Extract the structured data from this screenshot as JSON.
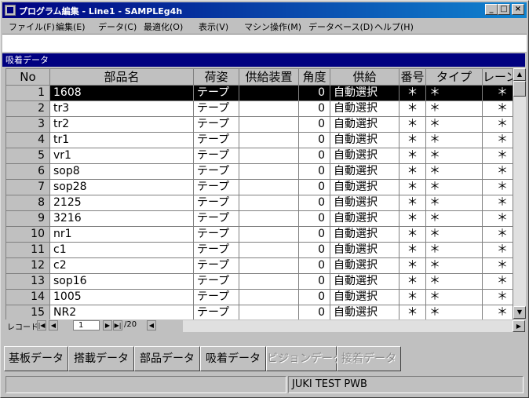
{
  "window": {
    "title": "プログラム編集 - Line1 - SAMPLEg4h"
  },
  "menu": [
    "ファイル(F)",
    "編集(E)",
    "データ(C)",
    "最適化(O)",
    "表示(V)",
    "マシン操作(M)",
    "データベース(D)",
    "ヘルプ(H)"
  ],
  "panel": {
    "title": "吸着データ"
  },
  "columns": [
    "No",
    "部品名",
    "荷姿",
    "供給装置",
    "角度",
    "供給",
    "番号",
    "タイプ",
    "レーン"
  ],
  "rows": [
    {
      "no": "1",
      "part": "1608",
      "packing": "テープ",
      "feeder": "",
      "angle": "0",
      "supply": "自動選択",
      "number": "＊",
      "type": "＊",
      "lane": "＊"
    },
    {
      "no": "2",
      "part": "tr3",
      "packing": "テープ",
      "feeder": "",
      "angle": "0",
      "supply": "自動選択",
      "number": "＊",
      "type": "＊",
      "lane": "＊"
    },
    {
      "no": "3",
      "part": "tr2",
      "packing": "テープ",
      "feeder": "",
      "angle": "0",
      "supply": "自動選択",
      "number": "＊",
      "type": "＊",
      "lane": "＊"
    },
    {
      "no": "4",
      "part": "tr1",
      "packing": "テープ",
      "feeder": "",
      "angle": "0",
      "supply": "自動選択",
      "number": "＊",
      "type": "＊",
      "lane": "＊"
    },
    {
      "no": "5",
      "part": "vr1",
      "packing": "テープ",
      "feeder": "",
      "angle": "0",
      "supply": "自動選択",
      "number": "＊",
      "type": "＊",
      "lane": "＊"
    },
    {
      "no": "6",
      "part": "sop8",
      "packing": "テープ",
      "feeder": "",
      "angle": "0",
      "supply": "自動選択",
      "number": "＊",
      "type": "＊",
      "lane": "＊"
    },
    {
      "no": "7",
      "part": "sop28",
      "packing": "テープ",
      "feeder": "",
      "angle": "0",
      "supply": "自動選択",
      "number": "＊",
      "type": "＊",
      "lane": "＊"
    },
    {
      "no": "8",
      "part": "2125",
      "packing": "テープ",
      "feeder": "",
      "angle": "0",
      "supply": "自動選択",
      "number": "＊",
      "type": "＊",
      "lane": "＊"
    },
    {
      "no": "9",
      "part": "3216",
      "packing": "テープ",
      "feeder": "",
      "angle": "0",
      "supply": "自動選択",
      "number": "＊",
      "type": "＊",
      "lane": "＊"
    },
    {
      "no": "10",
      "part": "nr1",
      "packing": "テープ",
      "feeder": "",
      "angle": "0",
      "supply": "自動選択",
      "number": "＊",
      "type": "＊",
      "lane": "＊"
    },
    {
      "no": "11",
      "part": "c1",
      "packing": "テープ",
      "feeder": "",
      "angle": "0",
      "supply": "自動選択",
      "number": "＊",
      "type": "＊",
      "lane": "＊"
    },
    {
      "no": "12",
      "part": "c2",
      "packing": "テープ",
      "feeder": "",
      "angle": "0",
      "supply": "自動選択",
      "number": "＊",
      "type": "＊",
      "lane": "＊"
    },
    {
      "no": "13",
      "part": "sop16",
      "packing": "テープ",
      "feeder": "",
      "angle": "0",
      "supply": "自動選択",
      "number": "＊",
      "type": "＊",
      "lane": "＊"
    },
    {
      "no": "14",
      "part": "1005",
      "packing": "テープ",
      "feeder": "",
      "angle": "0",
      "supply": "自動選択",
      "number": "＊",
      "type": "＊",
      "lane": "＊"
    },
    {
      "no": "15",
      "part": "NR2",
      "packing": "テープ",
      "feeder": "",
      "angle": "0",
      "supply": "自動選択",
      "number": "＊",
      "type": "＊",
      "lane": "＊"
    }
  ],
  "selected_row": 1,
  "nav": {
    "record_label": "レコード",
    "current": "1",
    "total": "/20"
  },
  "tabs": [
    {
      "label": "基板データ",
      "enabled": true
    },
    {
      "label": "搭載データ",
      "enabled": true
    },
    {
      "label": "部品データ",
      "enabled": true
    },
    {
      "label": "吸着データ",
      "enabled": true
    },
    {
      "label": "ビジョンデータ",
      "enabled": false
    },
    {
      "label": "接着データ",
      "enabled": false
    }
  ],
  "status": {
    "left": "",
    "right": "JUKI TEST PWB"
  },
  "icons": [
    "app-icon",
    "minimize-icon",
    "maximize-icon",
    "close-icon",
    "scroll-up-icon",
    "scroll-down-icon",
    "first-record-icon",
    "prev-record-icon",
    "next-record-icon",
    "last-record-icon"
  ]
}
